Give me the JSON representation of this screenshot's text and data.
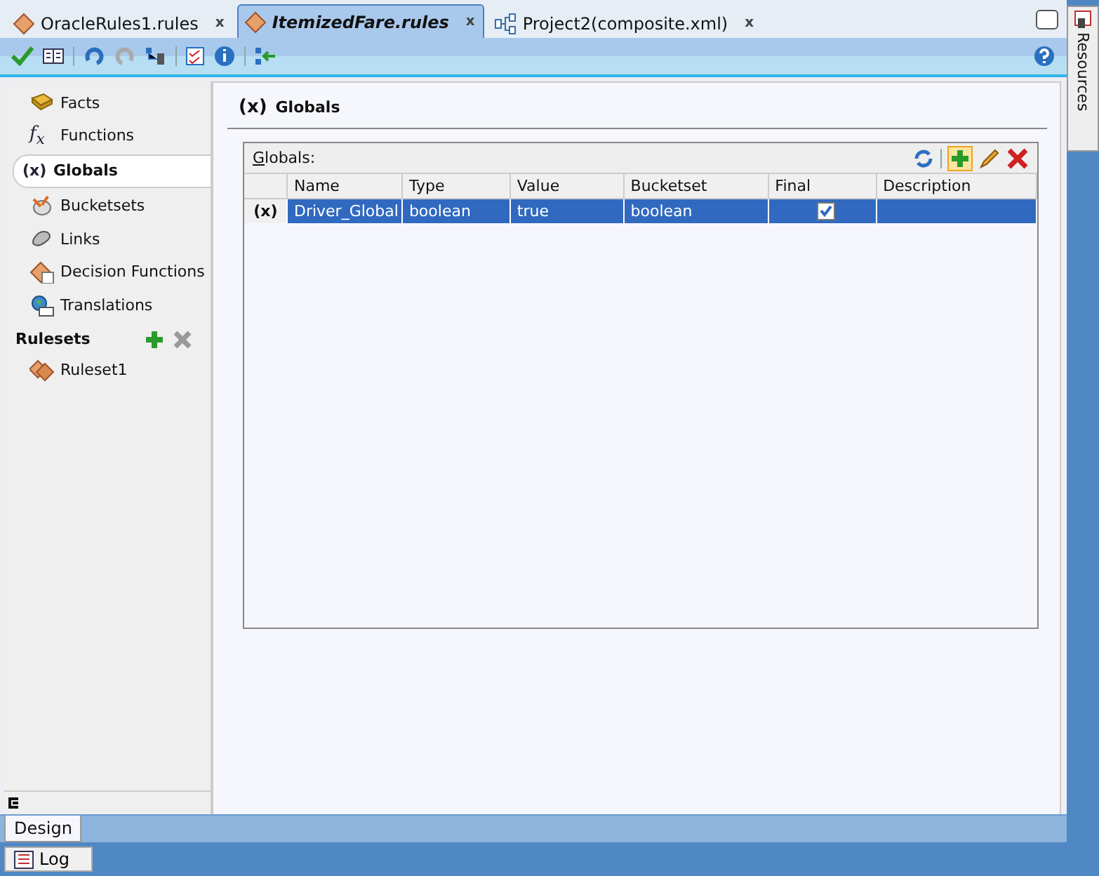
{
  "editor_tabs": [
    {
      "label": "OracleRules1.rules",
      "kind": "rules",
      "selected": false,
      "close": "x"
    },
    {
      "label": "ItemizedFare.rules",
      "kind": "rules",
      "selected": true,
      "close": "x"
    },
    {
      "label": "Project2(composite.xml)",
      "kind": "composite",
      "selected": false,
      "close": "x"
    }
  ],
  "side_tab": {
    "label": "Resources"
  },
  "sidebar": {
    "items": [
      {
        "label": "Facts",
        "kind": "facts",
        "selected": false
      },
      {
        "label": "Functions",
        "kind": "functions",
        "icon_text": "f$_{x}$",
        "selected": false
      },
      {
        "label": "Globals",
        "kind": "globals",
        "icon_text": "(x)",
        "selected": true
      },
      {
        "label": "Bucketsets",
        "kind": "bucketsets",
        "selected": false
      },
      {
        "label": "Links",
        "kind": "links",
        "selected": false
      },
      {
        "label": "Decision Functions",
        "kind": "decision",
        "selected": false
      },
      {
        "label": "Translations",
        "kind": "translations",
        "selected": false
      }
    ],
    "rulesets_heading": "Rulesets",
    "rulesets": [
      {
        "label": "Ruleset1",
        "selected": false
      }
    ]
  },
  "panel": {
    "title_icon": "(x)",
    "title": "Globals",
    "table_label": "Globals:",
    "columns": [
      "Name",
      "Type",
      "Value",
      "Bucketset",
      "Final",
      "Description"
    ],
    "rows": [
      {
        "marker": "(x)",
        "name": "Driver_Global",
        "type": "boolean",
        "value": "true",
        "bucketset": "boolean",
        "final": true,
        "description": "",
        "selected": true
      }
    ]
  },
  "bottom_tabs": [
    {
      "label": "Design",
      "selected": true
    }
  ],
  "log_button": "Log"
}
